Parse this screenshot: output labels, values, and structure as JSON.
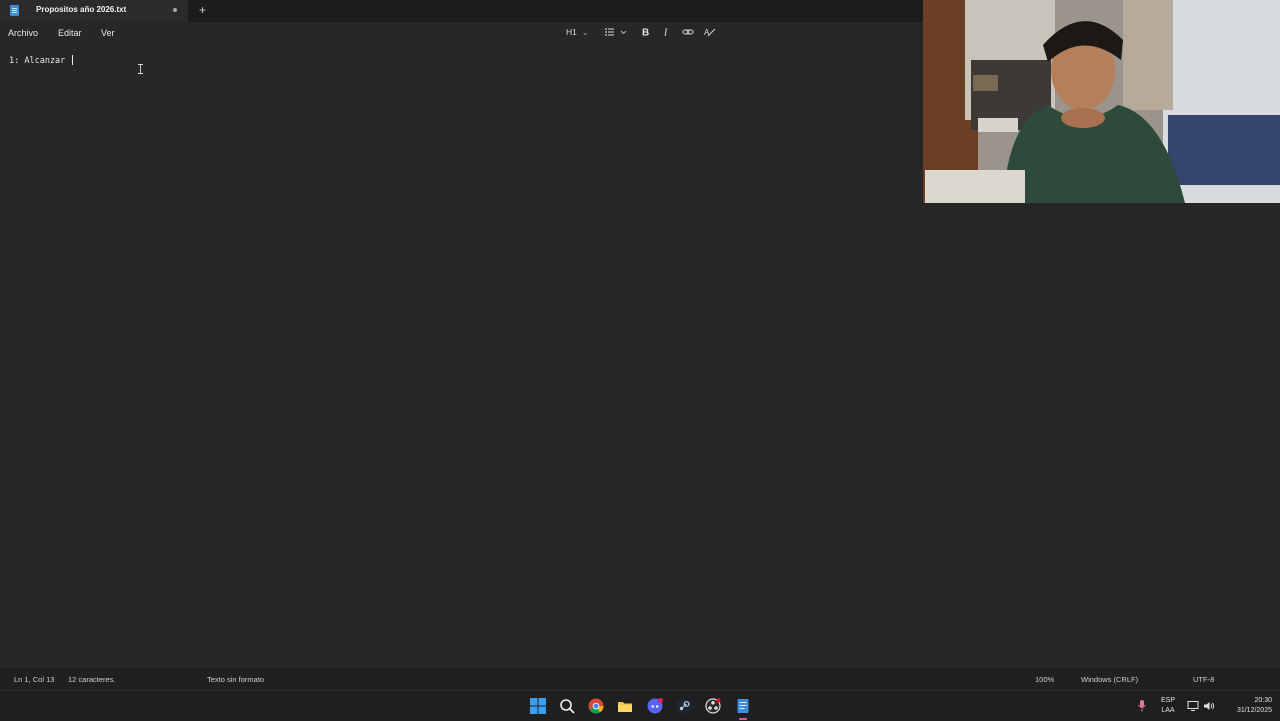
{
  "titlebar": {
    "tab_title": "Propositos año 2026.txt",
    "add_tab": "+"
  },
  "menu": {
    "items": [
      "Archivo",
      "Editar",
      "Ver"
    ]
  },
  "toolbar": {
    "heading": "H1",
    "bold_icon": "bold-icon",
    "italic_icon": "italic-icon",
    "link_icon": "link-icon",
    "list_icon": "list-icon",
    "clear_format_icon": "clear-formatting-icon"
  },
  "editor": {
    "line1": "1: Alcanzar "
  },
  "status": {
    "position": "Ln 1, Col 13",
    "chars": "12 caracteres.",
    "format": "Texto sin formato",
    "zoom": "100%",
    "line_ending": "Windows (CRLF)",
    "encoding": "UTF-8"
  },
  "taskbar": {
    "lang_top": "ESP",
    "lang_bottom": "LAA",
    "time": "20:30",
    "date": "31/12/2025"
  },
  "colors": {
    "accent": "#3a8edb",
    "background": "#272727",
    "titlebar": "#1c1c1c",
    "taskbar": "#1f1f1f",
    "active_indicator": "#ff4f9a"
  }
}
